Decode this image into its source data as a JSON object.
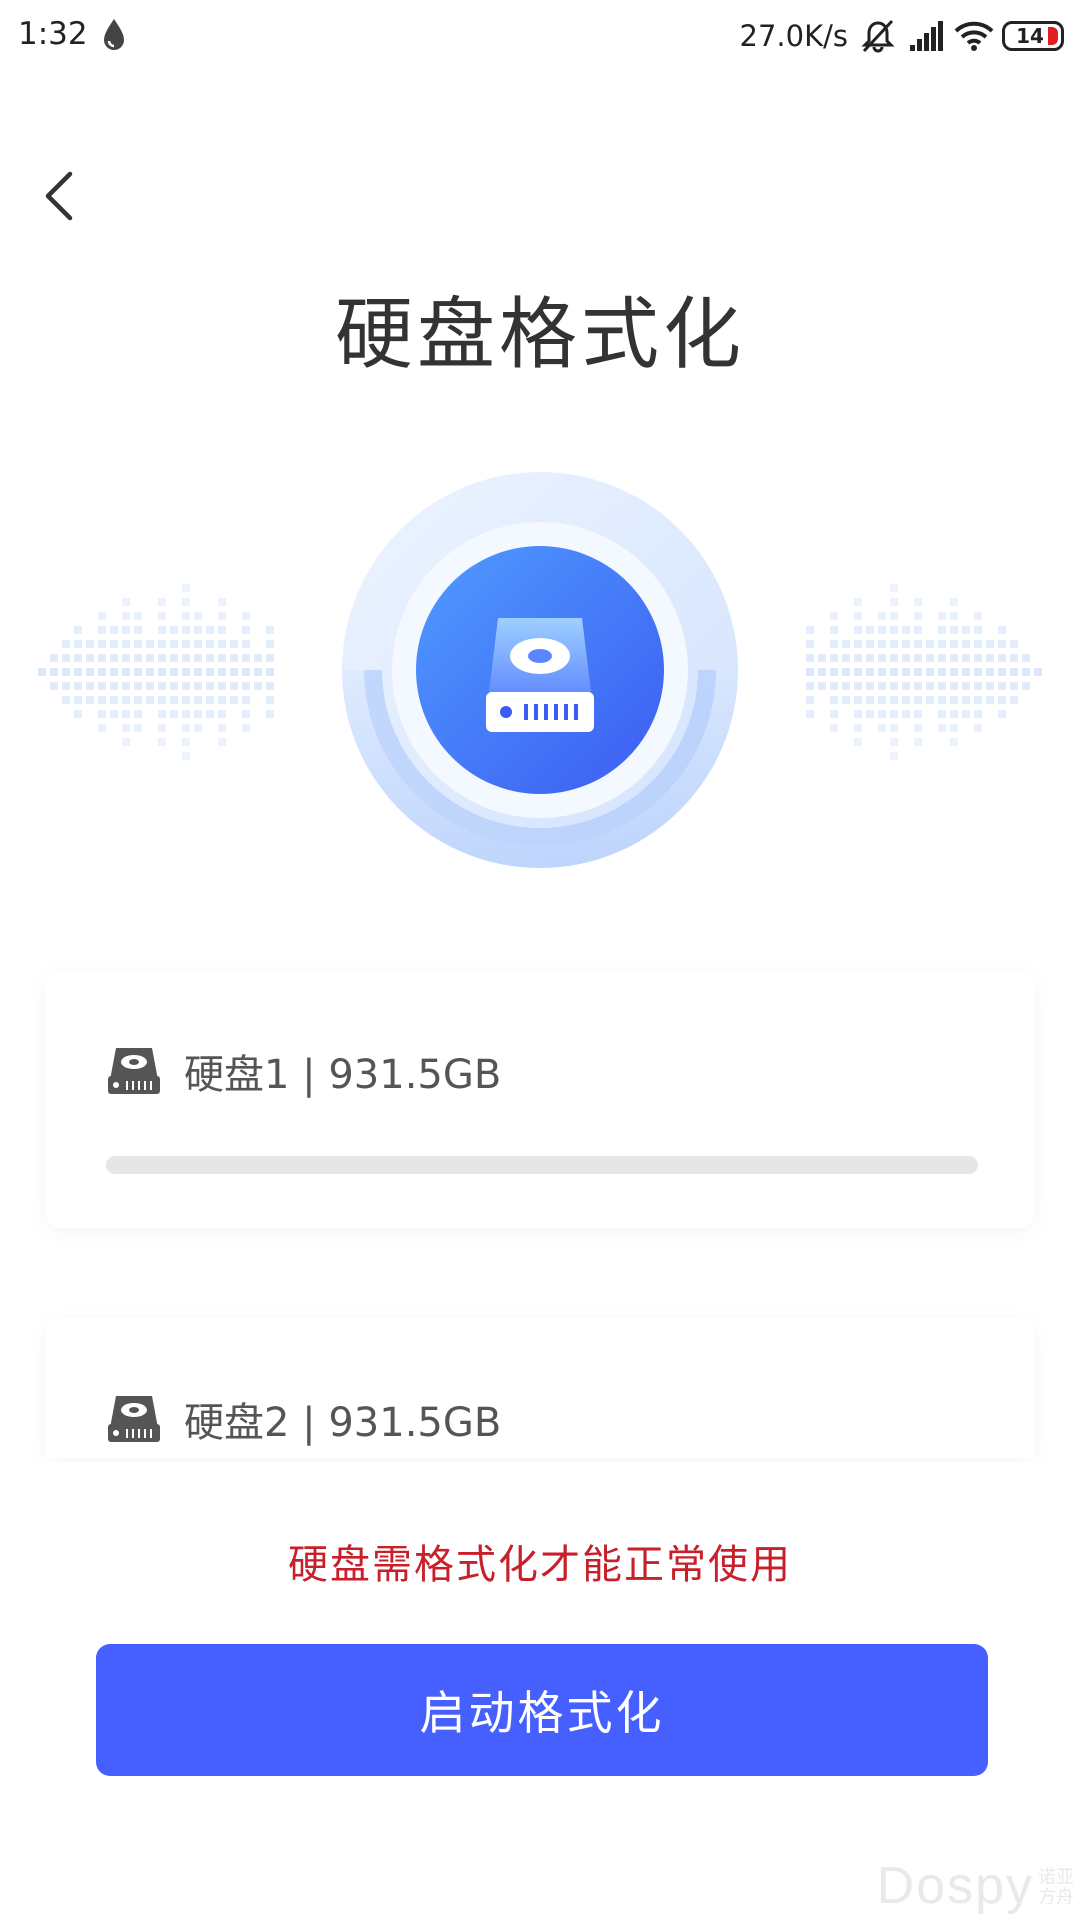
{
  "status_bar": {
    "time": "1:32",
    "net_speed": "27.0K/s",
    "battery_level": "14",
    "icons": [
      "droplet-icon",
      "bell-muted-icon",
      "signal-icon",
      "wifi-icon",
      "battery-icon"
    ]
  },
  "header": {
    "back_icon": "chevron-left-icon",
    "title": "硬盘格式化"
  },
  "hero": {
    "icon": "hard-drive-icon"
  },
  "disks": [
    {
      "label": "硬盘1 | 931.5GB",
      "progress": 0,
      "icon": "hard-drive-icon"
    },
    {
      "label": "硬盘2 | 931.5GB",
      "icon": "hard-drive-icon"
    }
  ],
  "warning": "硬盘需格式化才能正常使用",
  "start_button": "启动格式化",
  "watermark": {
    "main": "Dospy",
    "sub_line1": "诺亚",
    "sub_line2": "方舟"
  },
  "colors": {
    "accent": "#4560ff",
    "warning": "#c8202a",
    "track": "#e6e6e6"
  }
}
